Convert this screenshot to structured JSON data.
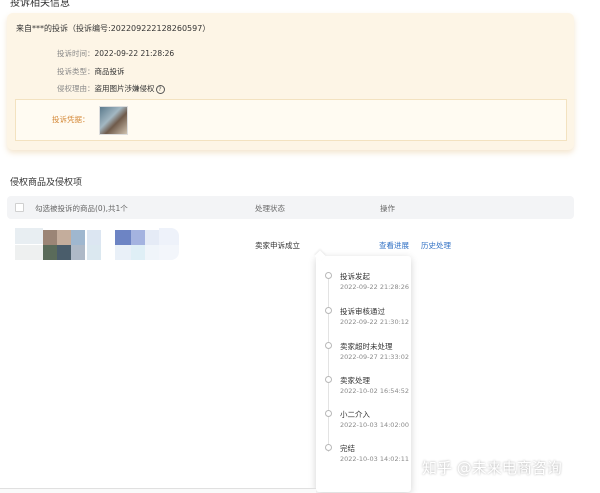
{
  "top_section": {
    "title": "投诉相关信息"
  },
  "complaint": {
    "header": "来自***的投诉（投诉编号:202209222128260597）",
    "rows": [
      {
        "label": "投诉时间：",
        "value": "2022-09-22 21:28:26"
      },
      {
        "label": "投诉类型：",
        "value": "商品投诉"
      },
      {
        "label": "侵权理由：",
        "value": "盗用图片涉嫌侵权"
      }
    ],
    "help_icon": "?",
    "evidence_label": "投诉凭据："
  },
  "infringement": {
    "title": "侵权商品及侵权项",
    "table": {
      "col_product": "勾选被投诉的商品(0),共1个",
      "col_status": "处理状态",
      "col_action": "操作"
    },
    "row": {
      "status": "卖家申诉成立",
      "view_progress": "查看进展",
      "history": "历史处理"
    }
  },
  "timeline": [
    {
      "title": "投诉发起",
      "time": "2022-09-22 21:28:26"
    },
    {
      "title": "投诉审核通过",
      "time": "2022-09-22 21:30:12"
    },
    {
      "title": "卖家超时未处理",
      "time": "2022-09-27 21:33:02"
    },
    {
      "title": "卖家处理",
      "time": "2022-10-02 16:54:52"
    },
    {
      "title": "小二介入",
      "time": "2022-10-03 14:02:00"
    },
    {
      "title": "完结",
      "time": "2022-10-03 14:02:11"
    }
  ],
  "watermark": "知乎 @未来电商咨询",
  "colors": {
    "card_bg": "#fdf5e6",
    "evidence_label": "#d58a3a",
    "link": "#2e6fc4",
    "table_header_bg": "#f3f4f6"
  }
}
